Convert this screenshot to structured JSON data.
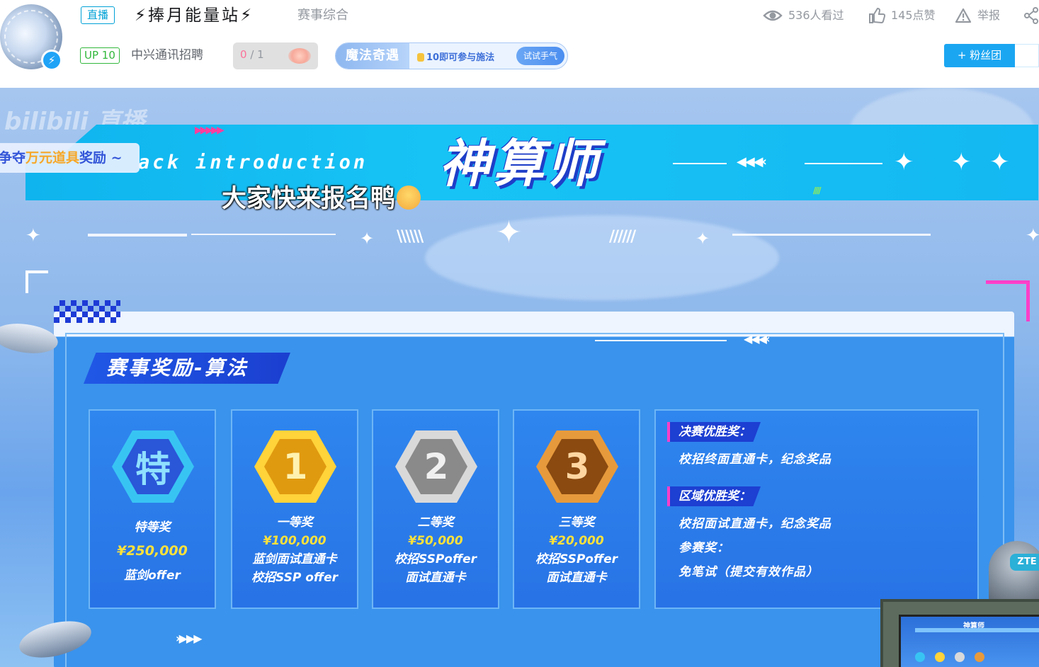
{
  "header": {
    "live_tag": "直播",
    "title": "⚡捧月能量站⚡",
    "area": "赛事综合",
    "views": "536人看过",
    "likes": "145点赞",
    "report": "举报",
    "up_level": "UP 10",
    "anchor_name": "中兴通讯招聘",
    "lottery": {
      "current": "0",
      "total": " / 1"
    },
    "magic": {
      "name": "魔法奇遇",
      "hint": "10即可参与施法",
      "try_label": "试试手气"
    },
    "fans_button": "+ 粉丝团"
  },
  "stream": {
    "watermark": "bilibili 直播",
    "promo": {
      "pre": "争夺",
      "highlight": "万元道具",
      "post": "奖励 ~"
    },
    "banner_subtitle": "ack introduction",
    "banner_title": "神算师",
    "danmaku": "大家快来报名鸭",
    "section_title": "赛事奖励-算法",
    "prizes": [
      {
        "badge": "特",
        "name": "特等奖",
        "amount": "¥250,000",
        "line1": "蓝剑offer",
        "line2": "",
        "hex_outer": "#38c4f3",
        "hex_inner": "#2a56d8",
        "hex_text": "#8fe0ff"
      },
      {
        "badge": "1",
        "name": "一等奖",
        "amount": "¥100,000",
        "line1": "蓝剑面试直通卡",
        "line2": "校招SSP offer",
        "hex_outer": "#ffd33a",
        "hex_inner": "#e09a10",
        "hex_text": "#fff2b0"
      },
      {
        "badge": "2",
        "name": "二等奖",
        "amount": "¥50,000",
        "line1": "校招SSPoffer",
        "line2": "面试直通卡",
        "hex_outer": "#d9d9d9",
        "hex_inner": "#8a8a8a",
        "hex_text": "#f0f0f0"
      },
      {
        "badge": "3",
        "name": "三等奖",
        "amount": "¥20,000",
        "line1": "校招SSPoffer",
        "line2": "面试直通卡",
        "hex_outer": "#e79a3c",
        "hex_inner": "#8a4a10",
        "hex_text": "#ffd6a0"
      }
    ],
    "info": {
      "final_tag": "决赛优胜奖：",
      "final_text": "校招终面直通卡，纪念奖品",
      "region_tag": "区域优胜奖：",
      "region_text": "校招面试直通卡，纪念奖品",
      "participate_label": "参赛奖：",
      "participate_text": "免笔试（提交有效作品）"
    },
    "pip_title": "神算师",
    "robot_logo": "ZTE"
  }
}
